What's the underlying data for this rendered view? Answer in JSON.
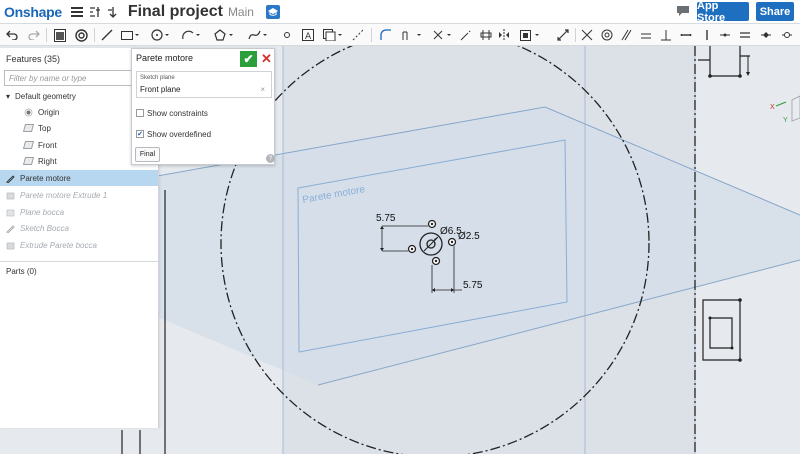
{
  "header": {
    "logo": "Onshape",
    "document_title": "Final project",
    "branch": "Main",
    "app_store_label": "App Store",
    "share_label": "Share"
  },
  "toolbar": {
    "tools": [
      "undo",
      "redo",
      "insert-sketch",
      "feature-list",
      "line",
      "rectangle",
      "circle",
      "arc",
      "spline",
      "point",
      "text",
      "construction",
      "fillet",
      "trim",
      "extend",
      "offset",
      "pattern",
      "mirror",
      "transform",
      "dimension",
      "constraints"
    ]
  },
  "feature_panel": {
    "title": "Features (35)",
    "filter_placeholder": "Filter by name or type",
    "default_geometry_label": "Default geometry",
    "geometry_items": [
      "Origin",
      "Top",
      "Front",
      "Right"
    ],
    "features": [
      {
        "label": "Parete motore",
        "state": "selected"
      },
      {
        "label": "Parete motore Extrude 1",
        "state": "rolled-back"
      },
      {
        "label": "Plane bocca",
        "state": "rolled-back"
      },
      {
        "label": "Sketch Bocca",
        "state": "rolled-back"
      },
      {
        "label": "Extrude Parete bocca",
        "state": "rolled-back"
      }
    ],
    "parts_label": "Parts (0)"
  },
  "sketch_dialog": {
    "title": "Parete motore",
    "sketch_plane_label": "Sketch plane",
    "sketch_plane_value": "Front plane",
    "clear_symbol": "×",
    "show_constraints_label": "Show constraints",
    "show_constraints_checked": false,
    "show_overdefined_label": "Show overdefined",
    "show_overdefined_checked": true,
    "final_label": "Final",
    "help_symbol": "?"
  },
  "viewport": {
    "sketch_name_label": "Parete motore",
    "dim_horizontal": "5.75",
    "dim_vertical": "5.75",
    "dim_large_diameter": "Ø6.5",
    "dim_small_diameter": "Ø2.5",
    "view_cube_axes": [
      "X",
      "Y"
    ]
  },
  "colors": {
    "brand_blue": "#1f6fc0",
    "accept_green": "#2b9f3a",
    "cancel_red": "#d9302b",
    "selection_blue": "#b7d7f1",
    "plane_blue": "#7fa6cf"
  }
}
